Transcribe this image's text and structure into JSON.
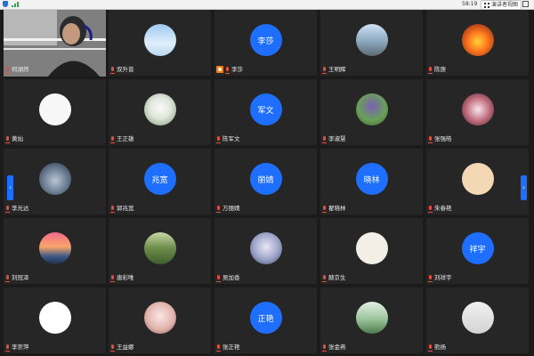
{
  "status_bar": {
    "time": "58:19",
    "view_button_label": "演讲者视图"
  },
  "participants": [
    {
      "name": "何湖然",
      "avatar_type": "video"
    },
    {
      "name": "双升普",
      "avatar_type": "image",
      "avatar": "sky"
    },
    {
      "name": "李莎",
      "avatar_type": "text",
      "avatar_text": "李莎",
      "host": true
    },
    {
      "name": "王明辉",
      "avatar_type": "image",
      "avatar": "road"
    },
    {
      "name": "陈庚",
      "avatar_type": "image",
      "avatar": "fire"
    },
    {
      "name": "黄灿",
      "avatar_type": "image",
      "avatar": "sketch"
    },
    {
      "name": "王正雄",
      "avatar_type": "image",
      "avatar": "rabbit"
    },
    {
      "name": "陈军文",
      "avatar_type": "text",
      "avatar_text": "军文"
    },
    {
      "name": "李淑慧",
      "avatar_type": "image",
      "avatar": "flower"
    },
    {
      "name": "张强皓",
      "avatar_type": "image",
      "avatar": "cherry"
    },
    {
      "name": "李光达",
      "avatar_type": "image",
      "avatar": "cat"
    },
    {
      "name": "郭兆宽",
      "avatar_type": "text",
      "avatar_text": "兆宽"
    },
    {
      "name": "万丽婧",
      "avatar_type": "text",
      "avatar_text": "丽婧"
    },
    {
      "name": "翟晓林",
      "avatar_type": "text",
      "avatar_text": "晓林"
    },
    {
      "name": "朱春艳",
      "avatar_type": "image",
      "avatar": "cartoon"
    },
    {
      "name": "刘冠泽",
      "avatar_type": "image",
      "avatar": "sunset"
    },
    {
      "name": "唐彩唯",
      "avatar_type": "image",
      "avatar": "park"
    },
    {
      "name": "吴加香",
      "avatar_type": "image",
      "avatar": "anime"
    },
    {
      "name": "赫京生",
      "avatar_type": "image",
      "avatar": "kids"
    },
    {
      "name": "刘祥宇",
      "avatar_type": "text",
      "avatar_text": "祥宇"
    },
    {
      "name": "李崇萍",
      "avatar_type": "image",
      "avatar": "rose"
    },
    {
      "name": "王益娜",
      "avatar_type": "image",
      "avatar": "girl"
    },
    {
      "name": "张正艳",
      "avatar_type": "text",
      "avatar_text": "正艳"
    },
    {
      "name": "张金燕",
      "avatar_type": "image",
      "avatar": "tree"
    },
    {
      "name": "熊扬",
      "avatar_type": "image",
      "avatar": "man"
    }
  ],
  "nav": {
    "prev_glyph": "‹",
    "next_glyph": "›"
  }
}
